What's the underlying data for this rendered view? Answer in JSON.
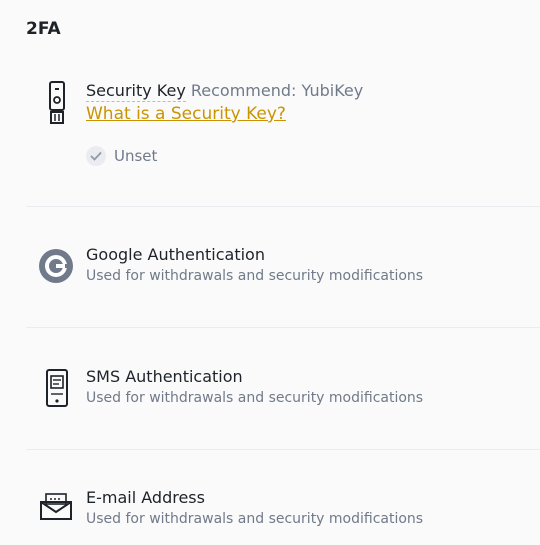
{
  "section": {
    "title": "2FA"
  },
  "methods": [
    {
      "title": "Security Key",
      "recommend": "Recommend: YubiKey",
      "link": "What is a Security Key?",
      "status": "Unset"
    },
    {
      "title": "Google Authentication",
      "subtitle": "Used for withdrawals and security modifications"
    },
    {
      "title": "SMS Authentication",
      "subtitle": "Used for withdrawals and security modifications"
    },
    {
      "title": "E-mail Address",
      "subtitle": "Used for withdrawals and security modifications"
    }
  ],
  "colors": {
    "link": "#c99400",
    "text_primary": "#1e2329",
    "text_secondary": "#707a8a",
    "divider": "#eaecef"
  },
  "icons": [
    "security-key-icon",
    "google-authenticator-icon",
    "sms-phone-icon",
    "email-envelope-icon",
    "check-icon"
  ]
}
